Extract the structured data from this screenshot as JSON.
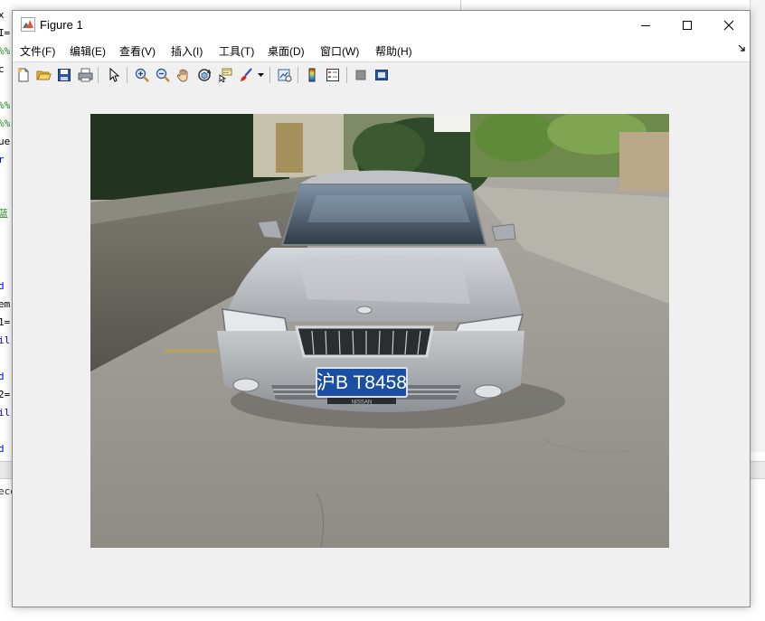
{
  "editor": {
    "code_fragments": [
      "x",
      "I=",
      "%%",
      "c",
      "%%",
      "%%",
      "ue",
      "r",
      "蓝",
      "d",
      "em",
      "1=",
      "il",
      "d",
      "2=",
      "il",
      "d"
    ],
    "command_fragment": "eco"
  },
  "window": {
    "title": "Figure 1",
    "icon": "matlab-figure-icon",
    "controls": [
      "minimize-icon",
      "maximize-icon",
      "close-icon"
    ]
  },
  "menu": {
    "items": [
      "文件(F)",
      "编辑(E)",
      "查看(V)",
      "插入(I)",
      "工具(T)",
      "桌面(D)",
      "窗口(W)",
      "帮助(H)"
    ],
    "dock_icon": "dock-arrow-icon"
  },
  "toolbar": {
    "buttons": [
      "new-figure-icon",
      "open-file-icon",
      "save-icon",
      "print-icon",
      "select-arrow-icon",
      "zoom-in-icon",
      "zoom-out-icon",
      "pan-hand-icon",
      "rotate-3d-icon",
      "data-cursor-icon",
      "brush-icon",
      "brush-dropdown-icon",
      "link-plot-icon",
      "insert-colorbar-icon",
      "insert-legend-icon",
      "hide-plot-tools-icon",
      "show-plot-tools-icon"
    ]
  },
  "image": {
    "subject": "silver sedan parked on concrete pavement",
    "license_plate": "沪B T8458",
    "plate_badge": "NISSAN",
    "colors": {
      "plate_bg": "#1b4fa3",
      "car_body": "#b9bcc0",
      "pavement": "#9c9a94",
      "foliage": "#2e4a2a"
    }
  }
}
